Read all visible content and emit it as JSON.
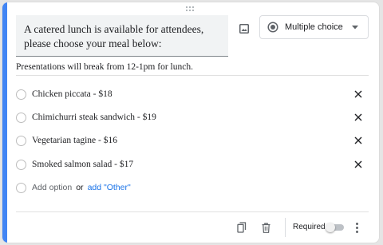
{
  "question": {
    "title": "A catered lunch is available for attendees, please choose your meal below:",
    "description": "Presentations will break from 12-1pm for lunch."
  },
  "question_type": {
    "selected": "Multiple choice",
    "icon": "radio-button-icon"
  },
  "options": [
    {
      "label": "Chicken piccata - $18"
    },
    {
      "label": "Chimichurri steak sandwich - $19"
    },
    {
      "label": "Vegetarian tagine - $16"
    },
    {
      "label": "Smoked salmon salad - $17"
    }
  ],
  "add_option": {
    "add_label": "Add option",
    "or_label": "or",
    "other_label": "add \"Other\""
  },
  "footer": {
    "required_label": "Required",
    "required_on": false,
    "icons": [
      "duplicate-icon",
      "delete-icon",
      "more-vert-icon"
    ]
  },
  "colors": {
    "accent": "#4285f4",
    "link": "#1a73e8",
    "text": "#202124",
    "icon": "#5f6368"
  }
}
